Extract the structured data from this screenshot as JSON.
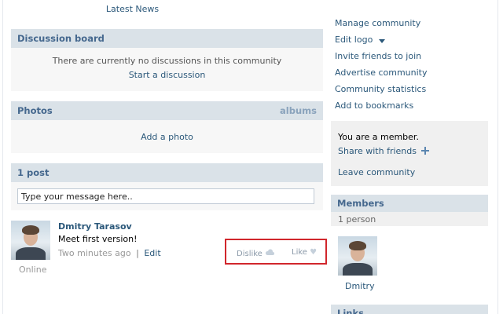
{
  "latest_news": "Latest News",
  "discussion": {
    "title": "Discussion board",
    "empty_text": "There are currently no discussions in this community",
    "start_link": "Start a discussion"
  },
  "photos": {
    "title": "Photos",
    "albums_link": "albums",
    "add_link": "Add a photo"
  },
  "posts": {
    "title": "1 post",
    "input_placeholder": "Type your message here..",
    "items": [
      {
        "author": "Dmitry Tarasov",
        "text": "Meet first version!",
        "time": "Two minutes ago",
        "separator": "|",
        "edit": "Edit",
        "status": "Online",
        "dislike_label": "Dislike",
        "like_label": "Like"
      }
    ]
  },
  "sidebar": {
    "actions": [
      "Manage community",
      "Edit logo",
      "Invite friends to join",
      "Advertise community",
      "Community statistics",
      "Add to bookmarks"
    ],
    "member_status": "You are a member.",
    "share_link": "Share with friends",
    "leave_link": "Leave community",
    "members": {
      "title": "Members",
      "count": "1 person",
      "list": [
        {
          "name": "Dmitry"
        }
      ]
    },
    "links_title": "Links"
  },
  "icons": {
    "dislike": "cloud-icon",
    "like": "heart-icon",
    "share_plus": "plus-icon",
    "dropdown": "caret-down-icon"
  },
  "colors": {
    "link": "#2b587a",
    "header_bg": "#dae2e8",
    "header_text": "#45688e",
    "highlight": "#d1262c"
  }
}
